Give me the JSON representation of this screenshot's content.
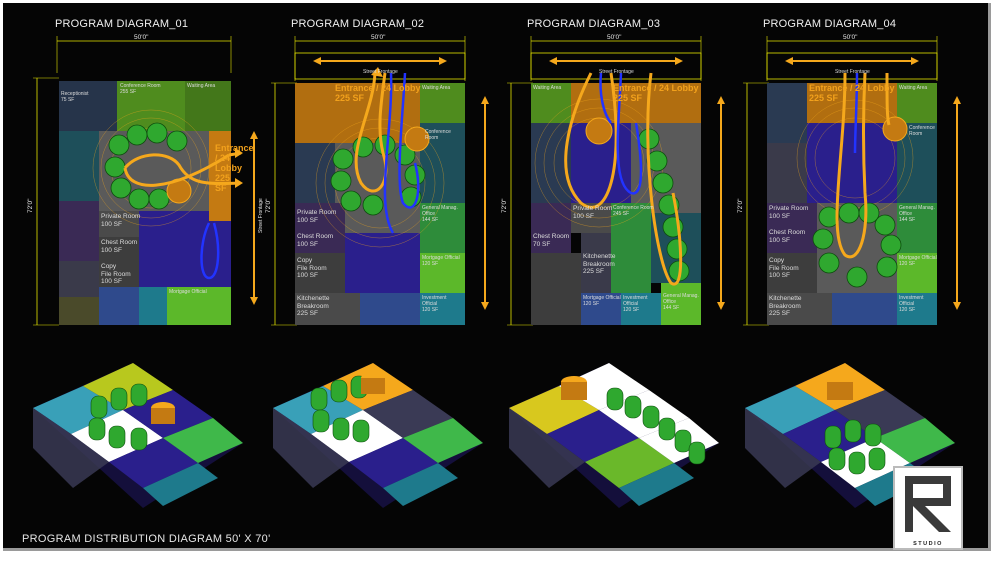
{
  "caption": "PROGRAM DISTRIBUTION DIAGRAM 50' X 70'",
  "logo": {
    "text": "STUDIO",
    "accent": "#c8102e",
    "icon": "studio-logo-icon"
  },
  "colors": {
    "background": "#050505",
    "dimension_line": "#e6e600",
    "circulation_primary": "#f5a81c",
    "circulation_secondary": "#2233ff",
    "seating": "#2fa82f"
  },
  "diagrams": [
    {
      "title": "PROGRAM DIAGRAM_01",
      "width_label": "50'0\"",
      "height_label": "72'0\"",
      "frontage": "Street Frontage",
      "rooms": {
        "entrance": "Entrance / 24 Lobby\n225 SF",
        "conference": "Conference Room\n255 SF",
        "waiting": "Waiting Area",
        "reception": "Receptionist\n75 SF",
        "private": "Private Room\n100 SF",
        "chest": "Chest Room\n100 SF",
        "copy": "Copy\nFile Room\n100 SF",
        "mortgage": "Mortgage Official"
      }
    },
    {
      "title": "PROGRAM DIAGRAM_02",
      "width_label": "50'0\"",
      "height_label": "72'0\"",
      "frontage": "Street Frontage",
      "rooms": {
        "entrance": "Entrance / 24 Lobby\n225 SF",
        "conference": "Conference\nRoom",
        "waiting": "Waiting Area",
        "private": "Private Room\n100 SF",
        "chest": "Chest Room\n100 SF",
        "copy": "Copy\nFile Room\n100 SF",
        "kitchenette": "Kitchenette\nBreakroom\n225 SF",
        "general": "General Manag.\nOffice\n144 SF",
        "mortgage": "Mortgage Official\n120 SF",
        "investment": "Investment\nOfficial\n120 SF"
      }
    },
    {
      "title": "PROGRAM DIAGRAM_03",
      "width_label": "50'0\"",
      "height_label": "72'0\"",
      "frontage": "Street Frontage",
      "rooms": {
        "entrance": "Entrance / 24 Lobby\n225 SF",
        "conference": "Conference Room\n245 SF",
        "waiting": "Waiting Area",
        "private": "Private Room\n100 SF",
        "chest": "Chest Room\n70 SF",
        "kitchenette": "Kitchenette\nBreakroom\n225 SF",
        "mortgage": "Mortgage Official\n120 SF",
        "investment": "Investment\nOfficial\n120 SF",
        "general": "General Manag.\nOffice\n144 SF"
      }
    },
    {
      "title": "PROGRAM DIAGRAM_04",
      "width_label": "50'0\"",
      "height_label": "72'0\"",
      "frontage": "Street Frontage",
      "rooms": {
        "entrance": "Entrance / 24 Lobby\n225 SF",
        "conference": "Conference\nRoom",
        "waiting": "Waiting Area",
        "private": "Private Room\n100 SF",
        "chest": "Chest Room\n100 SF",
        "copy": "Copy\nFile Room\n100 SF",
        "kitchenette": "Kitchenette\nBreakroom\n225 SF",
        "general": "General Manag.\nOffice\n144 SF",
        "mortgage": "Mortgage Official\n120 SF",
        "investment": "Investment\nOfficial\n120 SF"
      }
    }
  ]
}
